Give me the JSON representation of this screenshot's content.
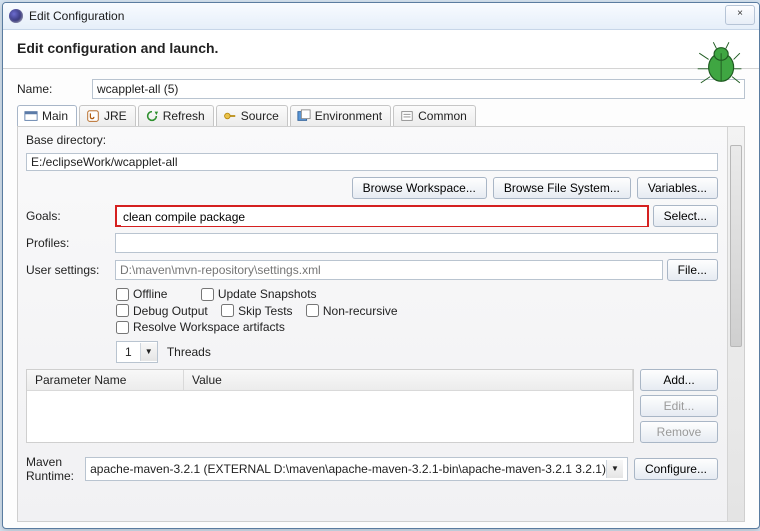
{
  "window": {
    "title": "Edit Configuration",
    "close_label": "×",
    "min_label": ""
  },
  "header": {
    "subtitle": "Edit configuration and launch."
  },
  "name": {
    "label": "Name:",
    "value": "wcapplet-all (5)"
  },
  "tabs": [
    {
      "label": "Main",
      "icon": "main"
    },
    {
      "label": "JRE",
      "icon": "jre"
    },
    {
      "label": "Refresh",
      "icon": "refresh"
    },
    {
      "label": "Source",
      "icon": "source"
    },
    {
      "label": "Environment",
      "icon": "env"
    },
    {
      "label": "Common",
      "icon": "common"
    }
  ],
  "main": {
    "base_directory_label": "Base directory:",
    "base_directory_value": "E:/eclipseWork/wcapplet-all",
    "browse_workspace": "Browse Workspace...",
    "browse_fs": "Browse File System...",
    "variables": "Variables...",
    "goals_label": "Goals:",
    "goals_value": "clean compile package",
    "select": "Select...",
    "profiles_label": "Profiles:",
    "profiles_value": "",
    "user_settings_label": "User settings:",
    "user_settings_hint": "D:\\maven\\mvn-repository\\settings.xml",
    "file_btn": "File...",
    "checks": {
      "offline": "Offline",
      "update_snapshots": "Update Snapshots",
      "debug_output": "Debug Output",
      "skip_tests": "Skip Tests",
      "non_recursive": "Non-recursive",
      "resolve_ws": "Resolve Workspace artifacts"
    },
    "threads_value": "1",
    "threads_label": "Threads",
    "param_table": {
      "name_header": "Parameter Name",
      "value_header": "Value"
    },
    "param_btns": {
      "add": "Add...",
      "edit": "Edit...",
      "remove": "Remove"
    },
    "maven_runtime_label": "Maven Runtime:",
    "maven_runtime_value": "apache-maven-3.2.1 (EXTERNAL D:\\maven\\apache-maven-3.2.1-bin\\apache-maven-3.2.1 3.2.1)",
    "configure": "Configure..."
  }
}
